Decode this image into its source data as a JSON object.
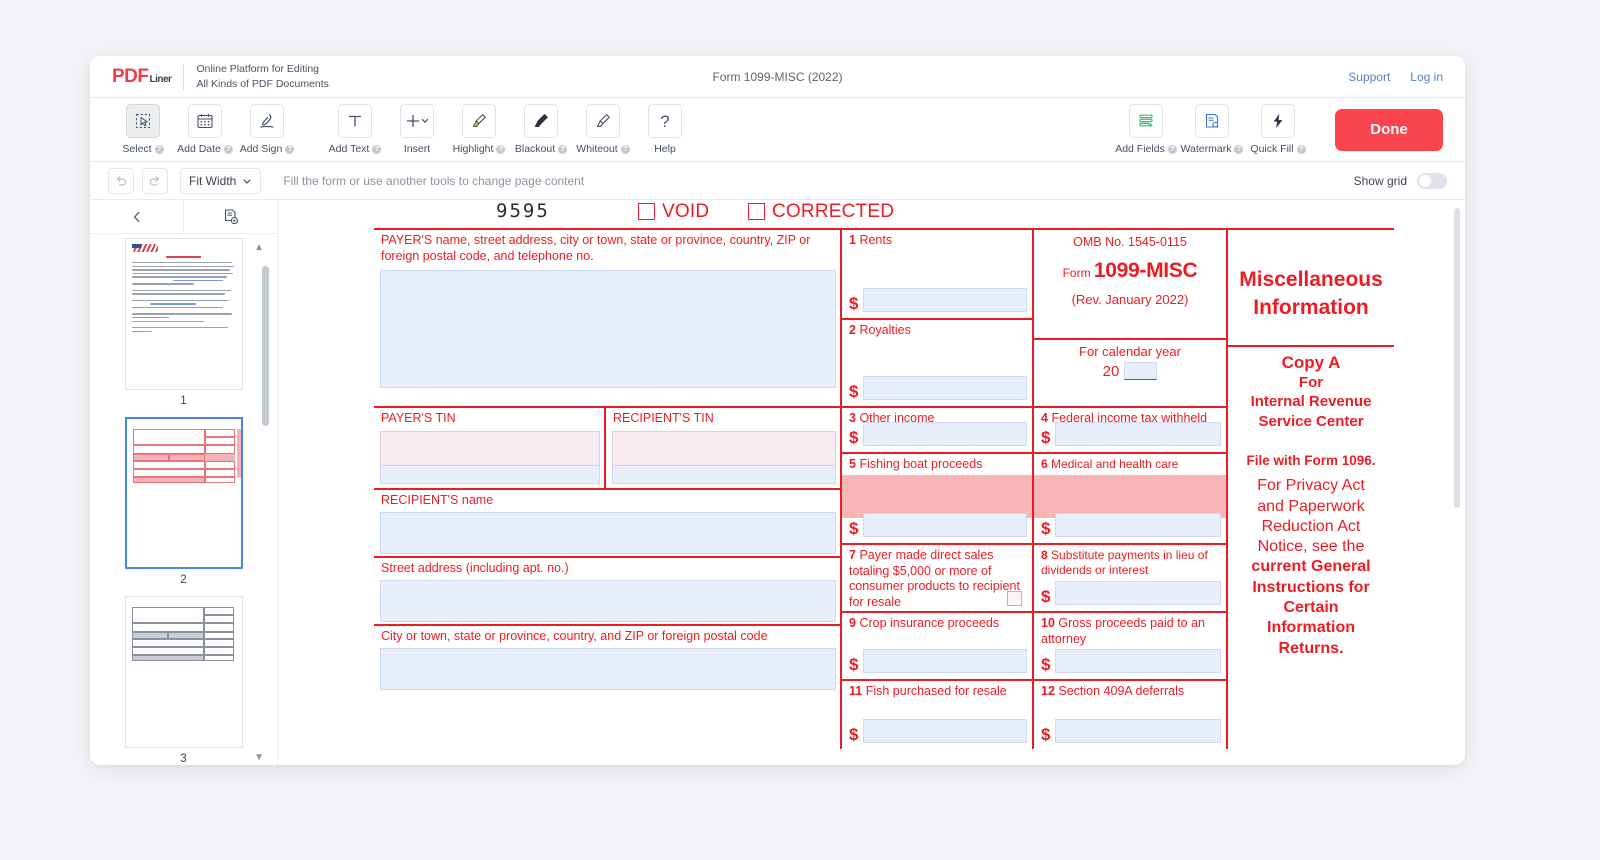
{
  "header": {
    "logo_text": "PDF",
    "logo_suffix": "Liner",
    "tagline_line1": "Online Platform for Editing",
    "tagline_line2": "All Kinds of PDF Documents",
    "title": "Form 1099-MISC (2022)",
    "support_label": "Support",
    "login_label": "Log in"
  },
  "toolbar": {
    "tools": [
      {
        "label": "Select",
        "icon": "select-cursor-icon",
        "help": true,
        "active": true
      },
      {
        "label": "Add Date",
        "icon": "calendar-icon",
        "help": true,
        "active": false
      },
      {
        "label": "Add Sign",
        "icon": "signature-pen-icon",
        "help": true,
        "active": false
      },
      {
        "label": "Add Text",
        "icon": "text-t-icon",
        "help": true,
        "active": false
      },
      {
        "label": "Insert",
        "icon": "plus-chevron-icon",
        "help": false,
        "active": false
      },
      {
        "label": "Highlight",
        "icon": "highlighter-icon",
        "help": true,
        "active": false
      },
      {
        "label": "Blackout",
        "icon": "blackout-brush-icon",
        "help": true,
        "active": false
      },
      {
        "label": "Whiteout",
        "icon": "whiteout-brush-icon",
        "help": true,
        "active": false
      },
      {
        "label": "Help",
        "icon": "question-mark-icon",
        "help": false,
        "active": false
      }
    ],
    "right_tools": [
      {
        "label": "Add Fields",
        "icon": "add-fields-icon",
        "help": true
      },
      {
        "label": "Watermark",
        "icon": "watermark-icon",
        "help": true
      },
      {
        "label": "Quick Fill",
        "icon": "lightning-bolt-icon",
        "help": true
      }
    ],
    "done_label": "Done"
  },
  "subbar": {
    "undo_icon": "undo-arrow-icon",
    "redo_icon": "redo-arrow-icon",
    "zoom_value": "Fit Width",
    "hint": "Fill the form or use another tools to change page content",
    "show_grid_label": "Show grid",
    "show_grid_on": false
  },
  "sidebar": {
    "collapse_icon": "chevron-left-icon",
    "page_settings_icon": "page-settings-icon",
    "pages": [
      {
        "number": "1",
        "selected": false
      },
      {
        "number": "2",
        "selected": true
      },
      {
        "number": "3",
        "selected": false
      }
    ]
  },
  "form": {
    "form_number": "9595",
    "void_label": "VOID",
    "corrected_label": "CORRECTED",
    "payer_name_label": "PAYER'S name, street address, city or town, state or province, country, ZIP or foreign postal code, and telephone no.",
    "payer_tin_label": "PAYER'S TIN",
    "recipient_tin_label": "RECIPIENT'S TIN",
    "recipient_name_label": "RECIPIENT'S name",
    "street_label": "Street address (including apt. no.)",
    "city_label": "City or town, state or province, country, and ZIP or foreign postal code",
    "boxes": {
      "b1_num": "1",
      "b1_label": "Rents",
      "b2_num": "2",
      "b2_label": "Royalties",
      "b3_num": "3",
      "b3_label": "Other income",
      "b4_num": "4",
      "b4_label": "Federal income tax withheld",
      "b5_num": "5",
      "b5_label": "Fishing boat proceeds",
      "b6_num": "6",
      "b6_label": "Medical and health care payments",
      "b7_num": "7",
      "b7_label": "Payer made direct sales totaling $5,000 or more of consumer products to recipient for resale",
      "b8_num": "8",
      "b8_label": "Substitute payments in lieu of dividends or interest",
      "b9_num": "9",
      "b9_label": "Crop insurance proceeds",
      "b10_num": "10",
      "b10_label": "Gross proceeds paid to an attorney",
      "b11_num": "11",
      "b11_label": "Fish purchased for resale",
      "b12_num": "12",
      "b12_label": "Section 409A deferrals"
    },
    "omb_no": "OMB No. 1545-0115",
    "form_word": "Form",
    "form_name": "1099-MISC",
    "revision": "(Rev. January 2022)",
    "calendar_year_label": "For calendar year",
    "calendar_year_prefix": "20",
    "calendar_year_value": "",
    "misc_title_line1": "Miscellaneous",
    "misc_title_line2": "Information",
    "copy_a": "Copy A",
    "copy_for": "For",
    "copy_irs1": "Internal Revenue",
    "copy_irs2": "Service Center",
    "file_with": "File with Form 1096.",
    "privacy_1": "For Privacy Act",
    "privacy_2": "and Paperwork",
    "privacy_3": "Reduction Act",
    "privacy_4": "Notice, see the",
    "privacy_5": "current General",
    "privacy_6": "Instructions for",
    "privacy_7": "Certain",
    "privacy_8": "Information",
    "privacy_9": "Returns.",
    "dollar_sign": "$"
  },
  "colors": {
    "irs_red": "#ed1c24",
    "accent_red": "#f7444e",
    "field_blue": "#e9eefb",
    "field_pink": "#f7eaf1",
    "highlight_red": "#f9b5b5",
    "link_blue": "#5b7fc7"
  }
}
